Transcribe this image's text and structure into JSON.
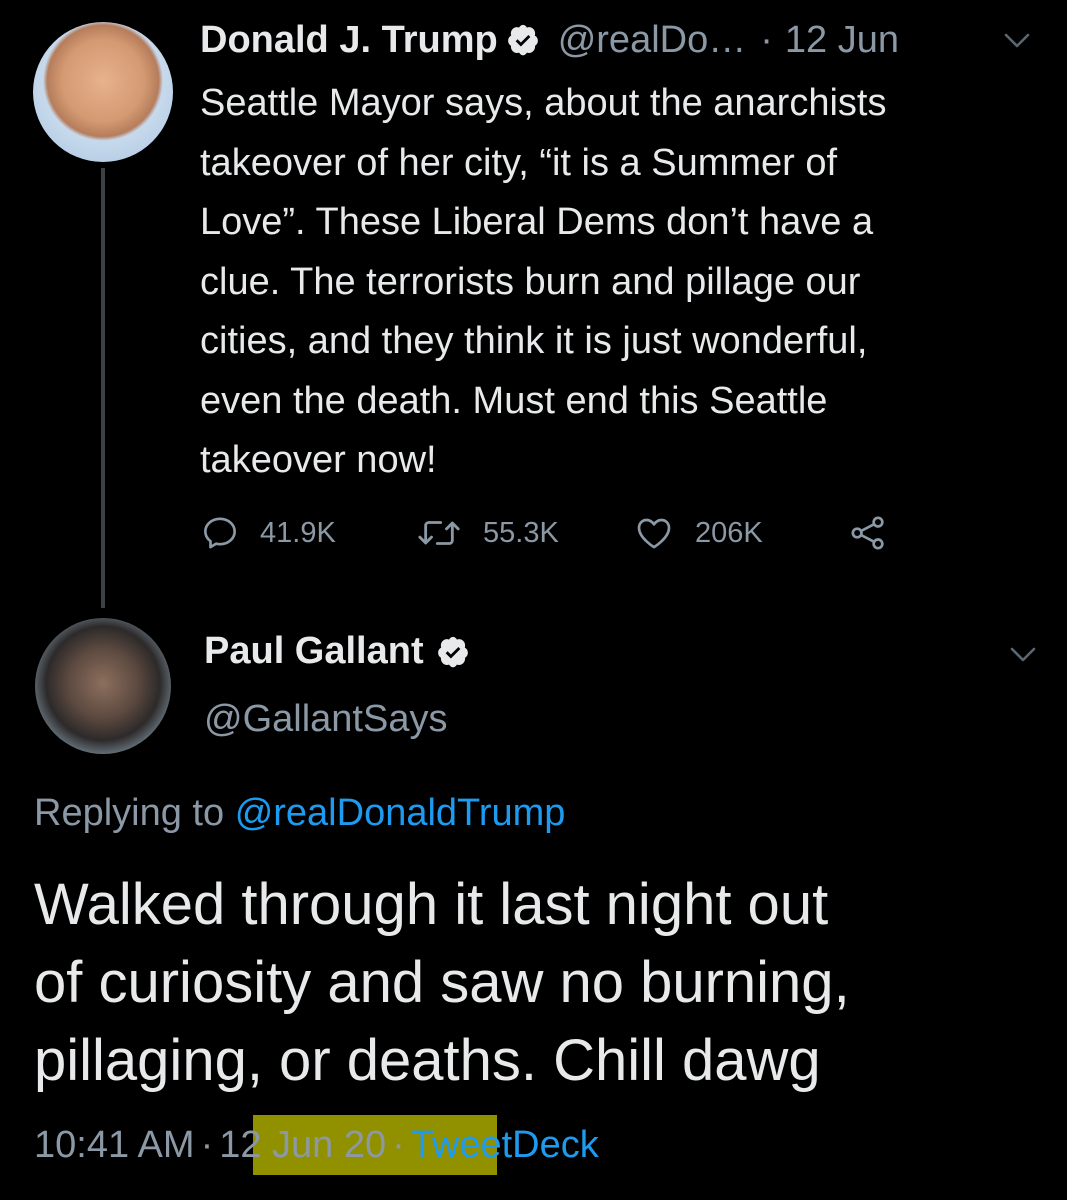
{
  "parent_tweet": {
    "display_name": "Donald J. Trump",
    "handle": "@realDo…",
    "separator": "·",
    "date": "12 Jun",
    "text_lines": [
      "Seattle Mayor says, about the anarchists",
      "takeover of her city, “it is a Summer of",
      "Love”. These Liberal Dems don’t have a",
      "clue. The terrorists burn and pillage our",
      "cities, and they think it is just wonderful,",
      "even the death. Must end this Seattle",
      "takeover now!"
    ],
    "replies": "41.9K",
    "retweets": "55.3K",
    "likes": "206K"
  },
  "reply_tweet": {
    "display_name": "Paul Gallant",
    "handle": "@GallantSays",
    "replying_prefix": "Replying to",
    "replying_to": "@realDonaldTrump",
    "text_lines": [
      "Walked through it last night out",
      "of curiosity and saw no burning,",
      "pillaging, or deaths. Chill dawg"
    ],
    "time": "10:41 AM",
    "separator": "·",
    "date": "12 Jun 20",
    "client": "TweetDeck"
  },
  "icons": {
    "verified": "verified-badge-icon",
    "reply": "reply-icon",
    "retweet": "retweet-icon",
    "like": "heart-icon",
    "share": "share-icon",
    "caret": "chevron-down-icon"
  },
  "colors": {
    "background": "#000000",
    "text": "#e7e9ea",
    "secondary": "#8b98a5",
    "link": "#1d9bf0",
    "highlight": "#c9c900"
  }
}
